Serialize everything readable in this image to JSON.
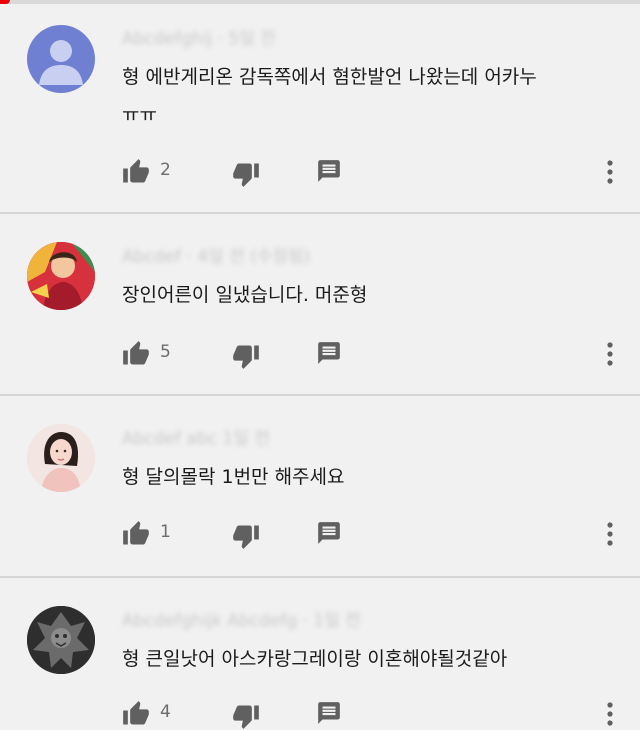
{
  "comments": [
    {
      "author": "Abcdefghij · 5일 전",
      "text_lines": [
        "형 에반게리온 감독쪽에서 혐한발언 나왔는데 어카누",
        "ㅠㅠ"
      ],
      "likes": "2",
      "avatar": "default-user-avatar",
      "avatar_color": "#6f7fd1"
    },
    {
      "author": "Abcdef · 4일 전 (수정됨)",
      "text_lines": [
        "장인어른이 일냈습니다. 머준형"
      ],
      "likes": "5",
      "avatar": "cartoon-avatar",
      "avatar_color": "#c9283a"
    },
    {
      "author": "Abcdef abc 1일 전",
      "text_lines": [
        "형 달의몰락 1번만 해주세요"
      ],
      "likes": "1",
      "avatar": "woman-photo-avatar",
      "avatar_color": "#efd9d2"
    },
    {
      "author": "Abcdefghijk Abcdefg · 1일 전",
      "text_lines": [
        "형 큰일낫어 아스카랑그레이랑 이혼해야될것같아"
      ],
      "likes": "4",
      "avatar": "dark-statue-avatar",
      "avatar_color": "#4a4a4a"
    }
  ],
  "icons": {
    "like": "thumb-up-icon",
    "dislike": "thumb-down-icon",
    "reply": "reply-icon",
    "more": "more-vertical-icon"
  },
  "colors": {
    "icon": "#606060",
    "background": "#f1f1f1",
    "divider": "#d6d6d6"
  }
}
